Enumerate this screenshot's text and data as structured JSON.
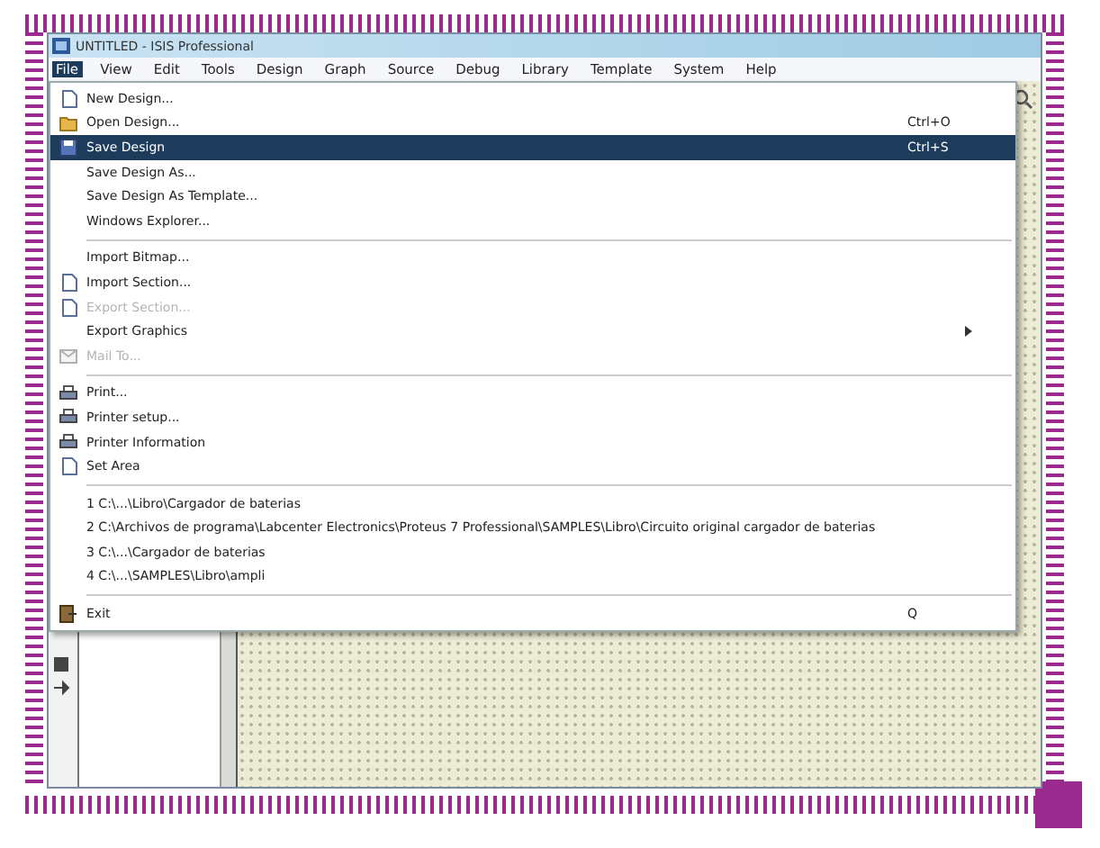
{
  "window": {
    "title": "UNTITLED - ISIS Professional"
  },
  "menu_bar": [
    {
      "label": "File",
      "selected": true
    },
    {
      "label": "View",
      "selected": false
    },
    {
      "label": "Edit",
      "selected": false
    },
    {
      "label": "Tools",
      "selected": false
    },
    {
      "label": "Design",
      "selected": false
    },
    {
      "label": "Graph",
      "selected": false
    },
    {
      "label": "Source",
      "selected": false
    },
    {
      "label": "Debug",
      "selected": false
    },
    {
      "label": "Library",
      "selected": false
    },
    {
      "label": "Template",
      "selected": false
    },
    {
      "label": "System",
      "selected": false
    },
    {
      "label": "Help",
      "selected": false
    }
  ],
  "file_menu": [
    [
      {
        "label": "New Design...",
        "kind": "document",
        "selected": false,
        "disabled": false
      },
      {
        "label": "Open Design...",
        "kind": "folder",
        "shortcut": "Ctrl+O",
        "selected": false,
        "disabled": false
      },
      {
        "label": "Save Design",
        "kind": "disk",
        "shortcut": "Ctrl+S",
        "selected": true,
        "disabled": false
      },
      {
        "label": "Save Design As...",
        "selected": false,
        "disabled": false
      },
      {
        "label": "Save Design As Template...",
        "selected": false,
        "disabled": false
      },
      {
        "label": "Windows Explorer...",
        "selected": false,
        "disabled": false
      }
    ],
    [
      {
        "label": "Import Bitmap...",
        "selected": false,
        "disabled": false
      },
      {
        "label": "Import Section...",
        "kind": "document",
        "selected": false,
        "disabled": false
      },
      {
        "label": "Export Section...",
        "kind": "document",
        "selected": false,
        "disabled": true
      },
      {
        "label": "Export Graphics",
        "submenu": true,
        "selected": false,
        "disabled": false
      },
      {
        "label": "Mail To...",
        "kind": "envelope",
        "selected": false,
        "disabled": true
      }
    ],
    [
      {
        "label": "Print...",
        "kind": "printer",
        "selected": false,
        "disabled": false
      },
      {
        "label": "Printer setup...",
        "kind": "printer",
        "selected": false,
        "disabled": false
      },
      {
        "label": "Printer Information",
        "kind": "printer",
        "selected": false,
        "disabled": false
      },
      {
        "label": "Set Area",
        "kind": "document",
        "selected": false,
        "disabled": false
      }
    ],
    [
      {
        "label": "1 C:\\...\\Libro\\Cargador de baterias",
        "selected": false,
        "disabled": false
      },
      {
        "label": "2 C:\\Archivos de programa\\Labcenter Electronics\\Proteus 7 Professional\\SAMPLES\\Libro\\Circuito original cargador de baterias",
        "selected": false,
        "disabled": false
      },
      {
        "label": "3 C:\\...\\Cargador de baterias",
        "selected": false,
        "disabled": false
      },
      {
        "label": "4 C:\\...\\SAMPLES\\Libro\\ampli",
        "selected": false,
        "disabled": false
      }
    ],
    [
      {
        "label": "Exit",
        "kind": "exit",
        "shortcut": "Q",
        "selected": false,
        "disabled": false
      }
    ]
  ]
}
